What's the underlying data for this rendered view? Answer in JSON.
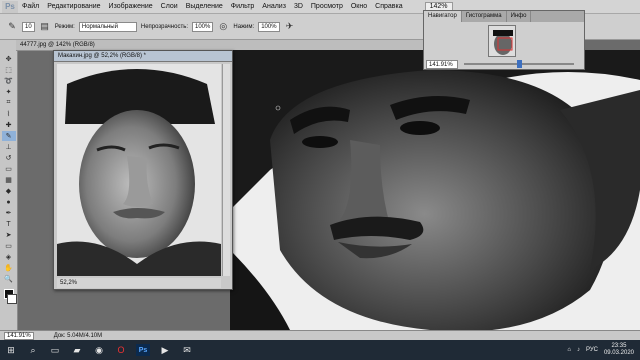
{
  "menubar": {
    "logo": "Ps",
    "items": [
      "Файл",
      "Редактирование",
      "Изображение",
      "Слои",
      "Выделение",
      "Фильтр",
      "Анализ",
      "3D",
      "Просмотр",
      "Окно",
      "Справка"
    ],
    "zoom_value": "142%"
  },
  "options": {
    "mode_label": "Режим:",
    "mode_value": "Нормальный",
    "opacity_label": "Непрозрачность:",
    "opacity_value": "100%",
    "pressure_label": "Нажим:",
    "pressure_value": "100%",
    "brush_size": "10"
  },
  "doc_tab": {
    "label": "44777.jpg @ 142% (RGB/8)"
  },
  "sub_window": {
    "title": "Макахин.jpg @ 52,2% (RGB/8) *",
    "zoom_status": "52,2%"
  },
  "navigator": {
    "tabs": [
      "Навигатор",
      "Гистограмма",
      "Инфо"
    ],
    "zoom_value": "141.91%"
  },
  "statusbar": {
    "zoom": "141.91%",
    "doc_info": "Док: 5.04M/4.10M"
  },
  "taskbar": {
    "ps_label": "Ps",
    "language": "РУС",
    "time": "23:35",
    "date": "09.03.2020"
  }
}
